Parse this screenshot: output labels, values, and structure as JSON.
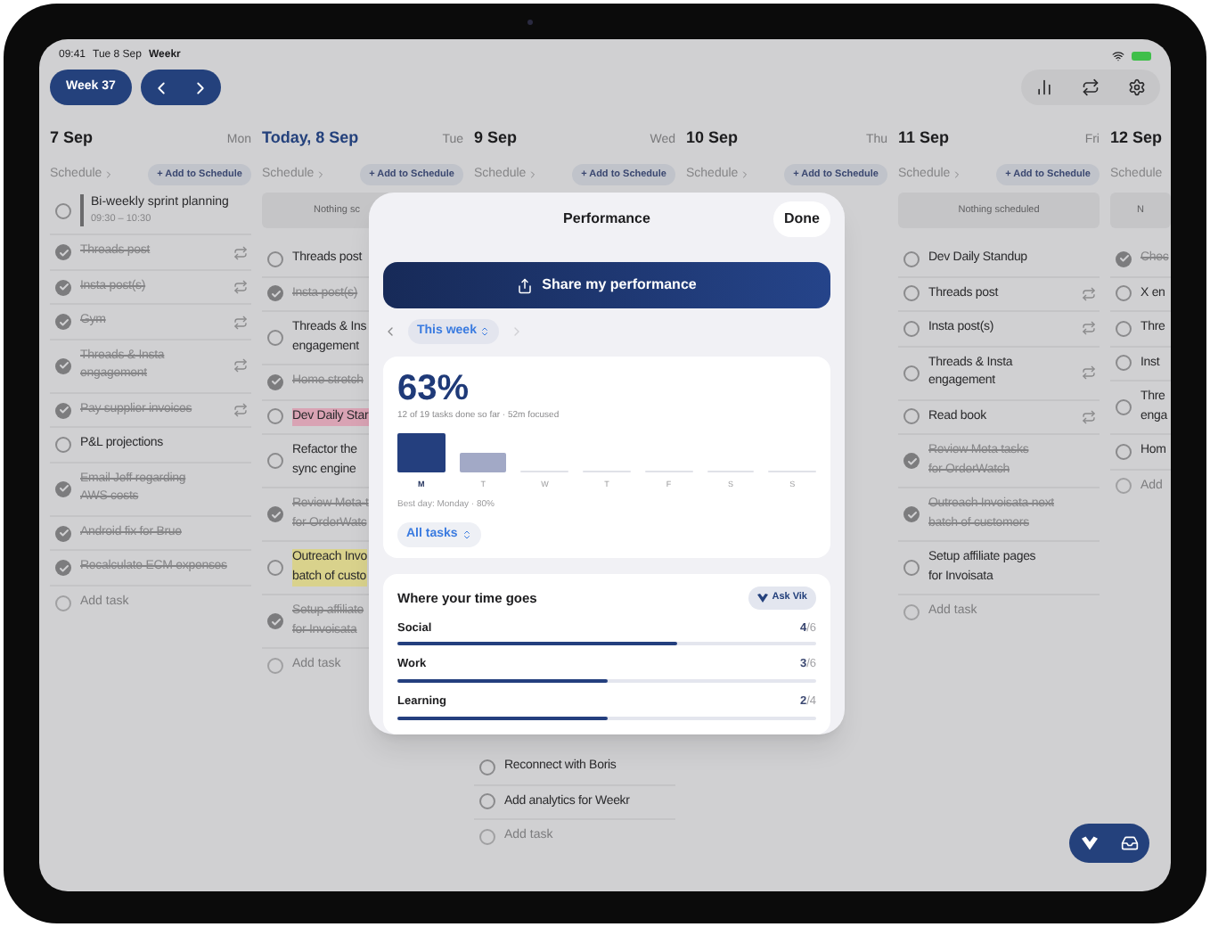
{
  "status_bar": {
    "time": "09:41",
    "date": "Tue 8 Sep",
    "app": "Weekr"
  },
  "toolbar": {
    "week": "Week 37"
  },
  "days": [
    {
      "title": "7 Sep",
      "weekday": "Mon",
      "today": false,
      "schedule": "Schedule",
      "add": "+ Add to Schedule",
      "events": [
        {
          "title": "Bi-weekly sprint planning",
          "time": "09:30 – 10:30"
        }
      ],
      "tasks": [
        {
          "text": "Threads post",
          "done": true,
          "repeat": true
        },
        {
          "text": "Insta post(s)",
          "done": true,
          "repeat": true
        },
        {
          "text": "Gym",
          "done": true,
          "repeat": true
        },
        {
          "text": "Threads & Insta\nengagement",
          "done": true,
          "repeat": true
        },
        {
          "text": "Pay supplier invoices",
          "done": true,
          "repeat": true
        },
        {
          "text": "P&L projections",
          "done": false,
          "repeat": false
        },
        {
          "text": "Email Jeff regarding\nAWS costs",
          "done": true,
          "repeat": false
        },
        {
          "text": "Android fix for Brue",
          "done": true,
          "repeat": false
        },
        {
          "text": "Recalculate ECM expenses",
          "done": true,
          "repeat": false
        }
      ],
      "add_task": "Add task"
    },
    {
      "title": "Today, 8 Sep",
      "weekday": "Tue",
      "today": true,
      "schedule": "Schedule",
      "add": "+ Add to Schedule",
      "empty": "Nothing sc",
      "tasks": [
        {
          "text": "Threads post",
          "done": false,
          "repeat": false
        },
        {
          "text": "Insta post(s)",
          "done": true,
          "repeat": false
        },
        {
          "text": "Threads & Ins\nengagement",
          "done": false,
          "repeat": false
        },
        {
          "text": "Home stretch",
          "done": true,
          "repeat": false
        },
        {
          "text": "Dev Daily Star",
          "done": false,
          "repeat": false,
          "color": "#d9a3b4"
        },
        {
          "text": "Refactor the\nsync engine",
          "done": false,
          "repeat": false
        },
        {
          "text": "Review Meta-t\nfor OrderWatc",
          "done": true,
          "repeat": false
        },
        {
          "text": "Outreach Invo\nbatch of custo",
          "done": false,
          "repeat": false,
          "color": "#d9d28c"
        },
        {
          "text": "Setup affiliate\nfor Invoisata",
          "done": true,
          "repeat": false
        }
      ],
      "add_task": "Add task"
    },
    {
      "title": "9 Sep",
      "weekday": "Wed",
      "today": false,
      "schedule": "Schedule",
      "add": "+ Add to Schedule",
      "tasks": [
        {
          "text": "Reconnect with Boris",
          "done": false,
          "repeat": false
        },
        {
          "text": "Add analytics for Weekr",
          "done": false,
          "repeat": false
        }
      ],
      "add_task": "Add task"
    },
    {
      "title": "10 Sep",
      "weekday": "Thu",
      "today": false,
      "schedule": "Schedule",
      "add": "+ Add to Schedule"
    },
    {
      "title": "11 Sep",
      "weekday": "Fri",
      "today": false,
      "schedule": "Schedule",
      "add": "+ Add to Schedule",
      "empty": "Nothing scheduled",
      "tasks": [
        {
          "text": "Dev Daily Standup",
          "done": false,
          "repeat": false
        },
        {
          "text": "Threads post",
          "done": false,
          "repeat": true
        },
        {
          "text": "Insta post(s)",
          "done": false,
          "repeat": true
        },
        {
          "text": "Threads & Insta\nengagement",
          "done": false,
          "repeat": true
        },
        {
          "text": "Read book",
          "done": false,
          "repeat": true
        },
        {
          "text": "Review Meta tasks\nfor OrderWatch",
          "done": true,
          "repeat": false
        },
        {
          "text": "Outreach Invoisata next\nbatch of customers",
          "done": true,
          "repeat": false
        },
        {
          "text": "Setup affiliate pages\nfor Invoisata",
          "done": false,
          "repeat": false
        }
      ],
      "add_task": "Add task"
    },
    {
      "title": "12 Sep",
      "today": false,
      "schedule": "Schedule",
      "empty": "N",
      "tasks": [
        {
          "text": "Chec",
          "done": true,
          "repeat": false
        },
        {
          "text": "X en",
          "done": false,
          "repeat": false
        },
        {
          "text": "Thre",
          "done": false,
          "repeat": false
        },
        {
          "text": "Inst",
          "done": false,
          "repeat": false
        },
        {
          "text": "Thre\nenga",
          "done": false,
          "repeat": false
        },
        {
          "text": "Hom",
          "done": false,
          "repeat": false
        }
      ],
      "add_task": "Add"
    }
  ],
  "performance": {
    "title": "Performance",
    "done": "Done",
    "share": "Share my performance",
    "period": "This week",
    "percent": "63%",
    "summary": "12 of 19 tasks done so far · 52m focused",
    "week": [
      {
        "label": "M",
        "selected": true
      },
      {
        "label": "T",
        "selected": false
      },
      {
        "label": "W",
        "selected": false
      },
      {
        "label": "T",
        "selected": false
      },
      {
        "label": "F",
        "selected": false
      },
      {
        "label": "S",
        "selected": false
      },
      {
        "label": "S",
        "selected": false
      }
    ],
    "best_day": "Best day: Monday · 80%",
    "filter": "All tasks",
    "section": "Where your time goes",
    "ask": "Ask Vik",
    "categories": [
      {
        "name": "Social",
        "count": "**4**/6",
        "level": 0.67
      },
      {
        "name": "Work",
        "count": "**3**/6",
        "level": 0.5
      },
      {
        "name": "Learning",
        "count": "**2**/4",
        "level": 0.5
      }
    ]
  }
}
